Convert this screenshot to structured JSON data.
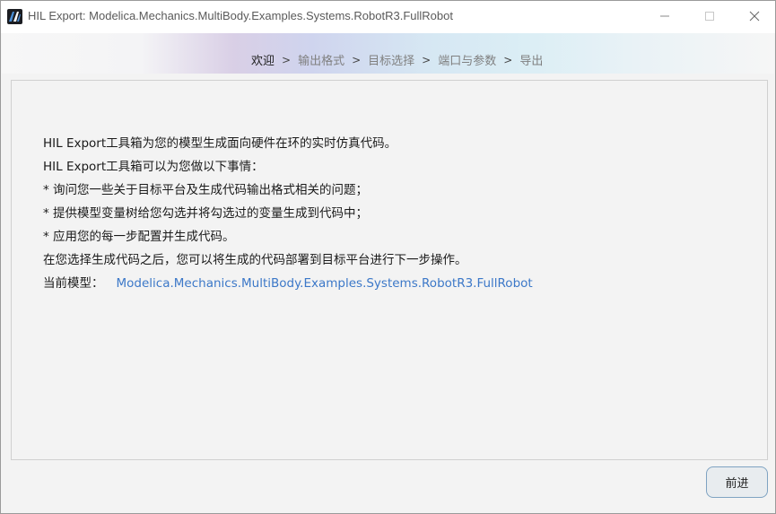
{
  "window": {
    "title": "HIL Export: Modelica.Mechanics.MultiBody.Examples.Systems.RobotR3.FullRobot",
    "icon": "app-logo-icon",
    "controls": {
      "minimize_icon": "minimize-icon",
      "maximize_icon": "maximize-icon",
      "close_icon": "close-icon"
    }
  },
  "breadcrumb": {
    "steps": [
      "欢迎",
      "输出格式",
      "目标选择",
      "端口与参数",
      "导出"
    ],
    "separator": ">",
    "active_index": 0
  },
  "content": {
    "lines": [
      "HIL Export工具箱为您的模型生成面向硬件在环的实时仿真代码。",
      "HIL Export工具箱可以为您做以下事情：",
      "* 询问您一些关于目标平台及生成代码输出格式相关的问题；",
      "* 提供模型变量树给您勾选并将勾选过的变量生成到代码中；",
      "* 应用您的每一步配置并生成代码。",
      "在您选择生成代码之后，您可以将生成的代码部署到目标平台进行下一步操作。"
    ],
    "model_label": "当前模型：",
    "model_value": "Modelica.Mechanics.MultiBody.Examples.Systems.RobotR3.FullRobot"
  },
  "footer": {
    "next_label": "前进"
  },
  "colors": {
    "link": "#3c78c8",
    "button_border": "#7fa3c2",
    "panel_bg": "#f3f3f3"
  }
}
